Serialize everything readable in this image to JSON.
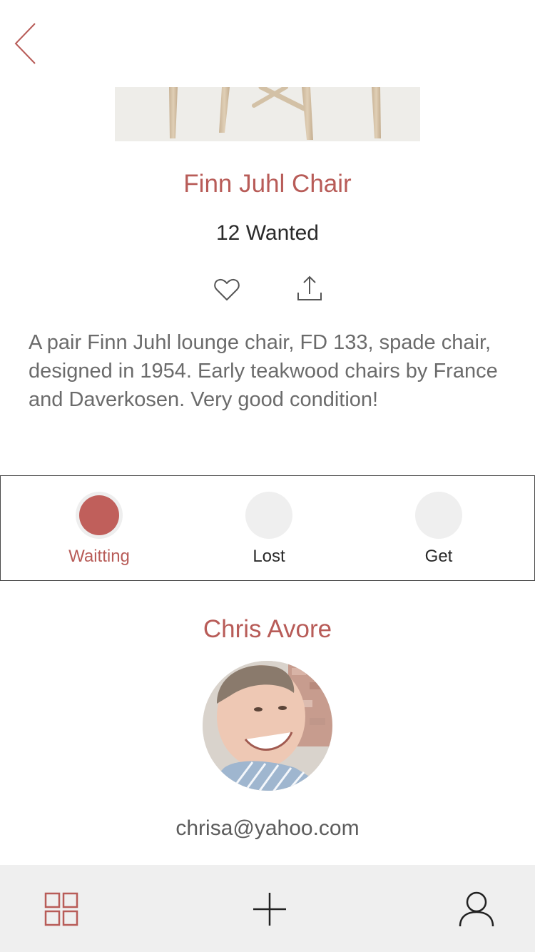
{
  "item": {
    "title": "Finn Juhl Chair",
    "wanted": "12 Wanted",
    "description": "A pair Finn Juhl lounge chair, FD 133, spade chair, designed in 1954. Early teakwood chairs by France and Daverkosen. Very good condition!"
  },
  "status": {
    "options": [
      {
        "label": "Waitting",
        "active": true
      },
      {
        "label": "Lost",
        "active": false
      },
      {
        "label": "Get",
        "active": false
      }
    ]
  },
  "seller": {
    "name": "Chris Avore",
    "email": "chrisa@yahoo.com"
  },
  "colors": {
    "accent": "#b85c58",
    "tabbar_bg": "#efefef"
  },
  "icons": {
    "back": "chevron-left-icon",
    "like": "heart-icon",
    "share": "share-icon",
    "tab_grid": "grid-icon",
    "tab_add": "plus-icon",
    "tab_profile": "user-icon"
  }
}
